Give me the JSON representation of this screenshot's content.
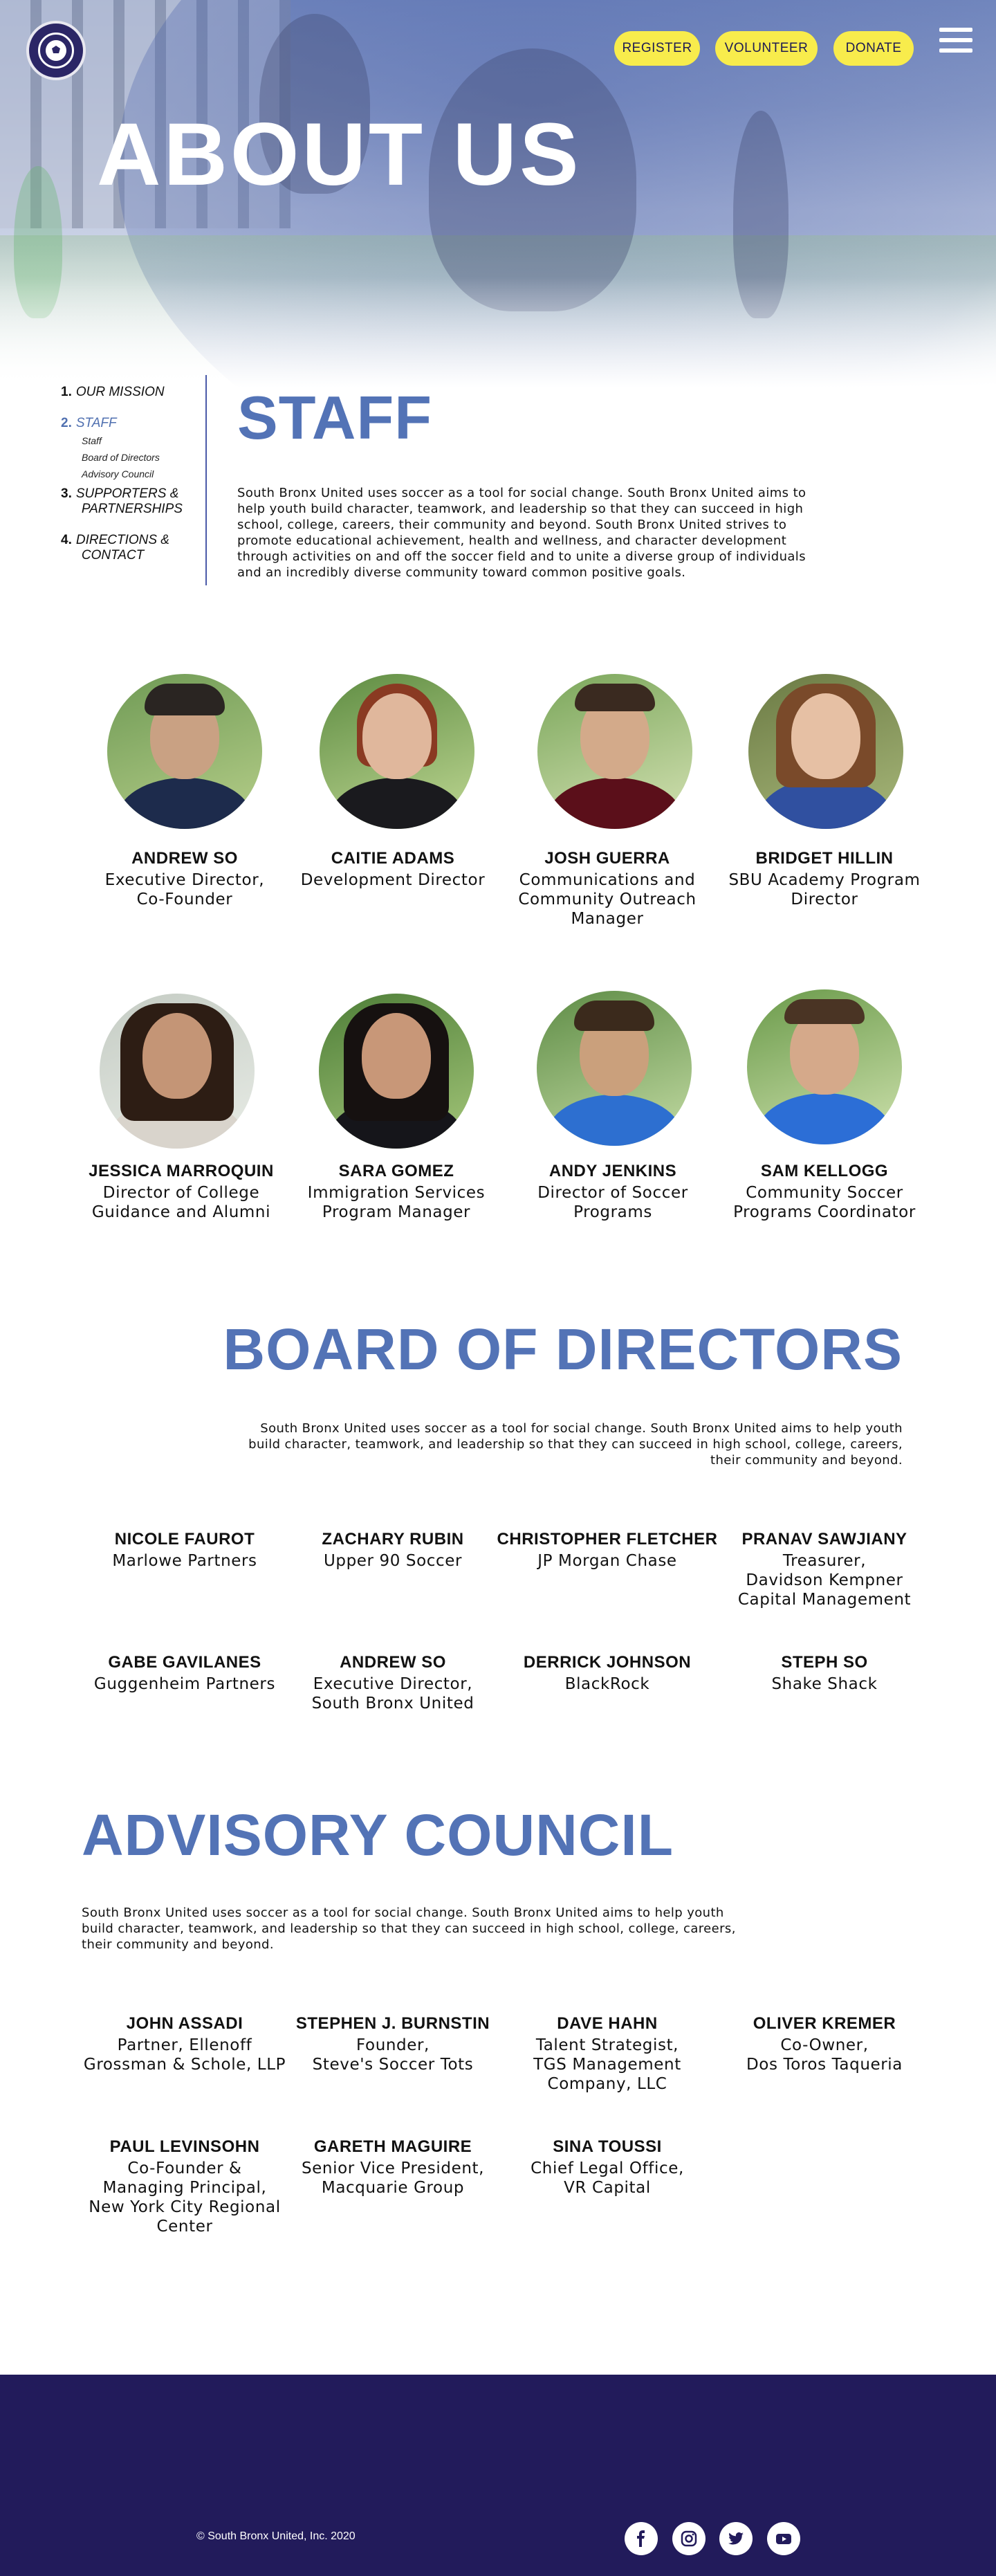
{
  "header": {
    "title": "ABOUT US",
    "buttons": [
      {
        "label": "REGISTER"
      },
      {
        "label": "VOLUNTEER"
      },
      {
        "label": "DONATE"
      }
    ],
    "accent_color": "#f8ec4c",
    "logo_icon": "south-bronx-united-crest-icon",
    "menu_icon": "hamburger-menu-icon"
  },
  "sidebar": {
    "items": [
      {
        "num": "1.",
        "label": "OUR MISSION"
      },
      {
        "num": "2.",
        "label": "STAFF"
      },
      {
        "num": "3.",
        "label": "SUPPORTERS &",
        "label2": "PARTNERSHIPS"
      },
      {
        "num": "4.",
        "label": "DIRECTIONS &",
        "label2": "CONTACT"
      }
    ],
    "subitems": [
      "Staff",
      "Board of Directors",
      "Advisory Council"
    ],
    "active_color": "#5070b0"
  },
  "staff": {
    "title": "STAFF",
    "intro": [
      "South Bronx United uses soccer as a tool for social change. South Bronx United aims to",
      "help youth build character, teamwork, and leadership so that they can succeed in high",
      "school, college, careers, their community and beyond. South Bronx United strives to",
      "promote educational achievement, health and wellness, and character development",
      "through activities on and off the soccer field and to unite a diverse group of individuals",
      "and an incredibly diverse community toward common positive goals."
    ],
    "members": [
      {
        "name": "ANDREW SO",
        "role": [
          "Executive Director,",
          "Co-Founder"
        ]
      },
      {
        "name": "CAITIE ADAMS",
        "role": [
          "Development Director"
        ]
      },
      {
        "name": "JOSH GUERRA",
        "role": [
          "Communications and",
          "Community Outreach",
          "Manager"
        ]
      },
      {
        "name": "BRIDGET HILLIN",
        "role": [
          "SBU Academy Program",
          "Director"
        ]
      },
      {
        "name": "JESSICA MARROQUIN",
        "role": [
          "Director of College",
          "Guidance and Alumni"
        ]
      },
      {
        "name": "SARA GOMEZ",
        "role": [
          "Immigration Services",
          "Program Manager"
        ]
      },
      {
        "name": "ANDY JENKINS",
        "role": [
          "Director of Soccer",
          "Programs"
        ]
      },
      {
        "name": "SAM KELLOGG",
        "role": [
          "Community Soccer",
          "Programs Coordinator"
        ]
      }
    ]
  },
  "board": {
    "title": "BOARD OF DIRECTORS",
    "intro": [
      "South Bronx United uses soccer as a tool for social change. South Bronx United aims to help youth",
      "build character, teamwork, and leadership so that they can succeed in high school, college, careers,",
      "their community and beyond."
    ],
    "members": [
      {
        "name": "NICOLE FAUROT",
        "role": [
          "Marlowe Partners"
        ]
      },
      {
        "name": "ZACHARY RUBIN",
        "role": [
          "Upper 90 Soccer"
        ]
      },
      {
        "name": "CHRISTOPHER FLETCHER",
        "role": [
          "JP Morgan Chase"
        ]
      },
      {
        "name": "PRANAV SAWJIANY",
        "role": [
          "Treasurer,",
          "Davidson Kempner",
          "Capital Management"
        ]
      },
      {
        "name": "GABE GAVILANES",
        "role": [
          "Guggenheim Partners"
        ]
      },
      {
        "name": "ANDREW SO",
        "role": [
          "Executive Director,",
          "South Bronx United"
        ]
      },
      {
        "name": "DERRICK JOHNSON",
        "role": [
          "BlackRock"
        ]
      },
      {
        "name": "STEPH SO",
        "role": [
          "Shake Shack"
        ]
      }
    ]
  },
  "advisory": {
    "title": "ADVISORY COUNCIL",
    "intro": [
      "South Bronx United uses soccer as a tool for social change. South Bronx United aims to help youth",
      "build character, teamwork, and leadership so that they can succeed in high school, college, careers,",
      "their community and beyond."
    ],
    "members": [
      {
        "name": "JOHN ASSADI",
        "role": [
          "Partner, Ellenoff",
          "Grossman & Schole, LLP"
        ]
      },
      {
        "name": "STEPHEN J. BURNSTIN",
        "role": [
          "Founder,",
          "Steve's Soccer Tots"
        ]
      },
      {
        "name": "DAVE HAHN",
        "role": [
          "Talent Strategist,",
          "TGS Management",
          "Company, LLC"
        ]
      },
      {
        "name": "OLIVER KREMER",
        "role": [
          "Co-Owner,",
          "Dos Toros Taqueria"
        ]
      },
      {
        "name": "PAUL LEVINSOHN",
        "role": [
          "Co-Founder &",
          "Managing Principal,",
          "New York City Regional",
          "Center"
        ]
      },
      {
        "name": "GARETH MAGUIRE",
        "role": [
          "Senior Vice President,",
          "Macquarie Group"
        ]
      },
      {
        "name": "SINA TOUSSI",
        "role": [
          "Chief Legal Office,",
          "VR Capital"
        ]
      }
    ]
  },
  "footer": {
    "copyright": "© South Bronx United, Inc. 2020",
    "background": "#221b5b",
    "social": [
      {
        "icon": "facebook-icon"
      },
      {
        "icon": "instagram-icon"
      },
      {
        "icon": "twitter-icon"
      },
      {
        "icon": "youtube-icon"
      }
    ]
  }
}
